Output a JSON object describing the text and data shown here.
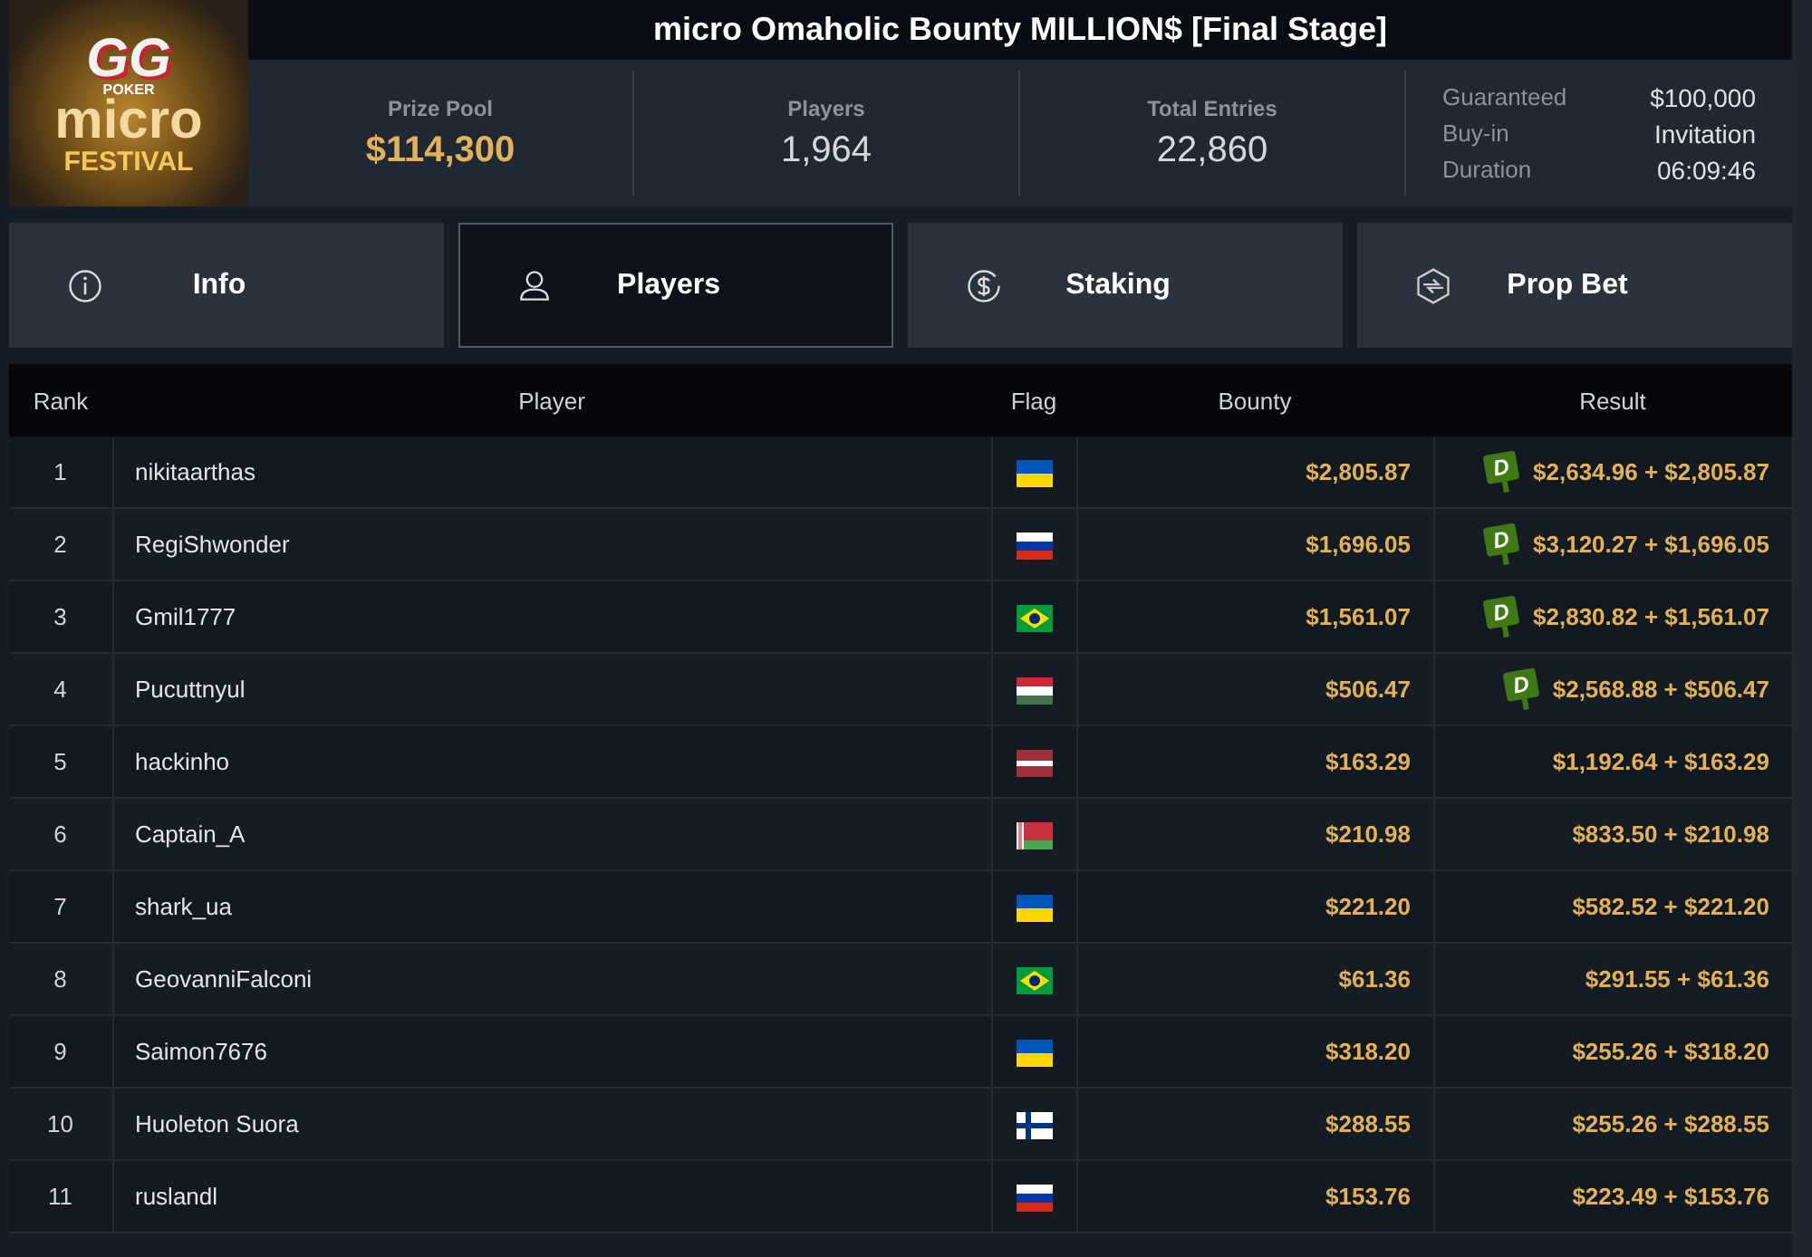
{
  "logo": {
    "brand": "GG",
    "sub": "POKER",
    "line1": "micro",
    "line2": "FESTIVAL"
  },
  "title": "micro Omaholic Bounty MILLION$ [Final Stage]",
  "stats": [
    {
      "label": "Prize Pool",
      "value": "$114,300",
      "kind": "money"
    },
    {
      "label": "Players",
      "value": "1,964",
      "kind": "plain"
    },
    {
      "label": "Total Entries",
      "value": "22,860",
      "kind": "plain"
    }
  ],
  "details": [
    {
      "label": "Guaranteed",
      "value": "$100,000"
    },
    {
      "label": "Buy-in",
      "value": "Invitation"
    },
    {
      "label": "Duration",
      "value": "06:09:46"
    }
  ],
  "tabs": [
    {
      "label": "Info",
      "selected": false
    },
    {
      "label": "Players",
      "selected": true
    },
    {
      "label": "Staking",
      "selected": false
    },
    {
      "label": "Prop Bet",
      "selected": false
    }
  ],
  "table": {
    "columns": [
      "Rank",
      "Player",
      "Flag",
      "Bounty",
      "Result"
    ],
    "rows": [
      {
        "rank": "1",
        "player": "nikitaarthas",
        "kind": "ua",
        "bounty": "$2,805.87",
        "deal": "D",
        "result": "$2,634.96 + $2,805.87"
      },
      {
        "rank": "2",
        "player": "RegiShwonder",
        "kind": "ru",
        "bounty": "$1,696.05",
        "deal": "D",
        "result": "$3,120.27 + $1,696.05"
      },
      {
        "rank": "3",
        "player": "Gmil1777",
        "kind": "br",
        "bounty": "$1,561.07",
        "deal": "D",
        "result": "$2,830.82 + $1,561.07"
      },
      {
        "rank": "4",
        "player": "Pucuttnyul",
        "kind": "hu",
        "bounty": "$506.47",
        "deal": "D",
        "result": "$2,568.88 + $506.47"
      },
      {
        "rank": "5",
        "player": "hackinho",
        "kind": "lv",
        "bounty": "$163.29",
        "result": "$1,192.64 + $163.29"
      },
      {
        "rank": "6",
        "player": "Captain_A",
        "kind": "by",
        "bounty": "$210.98",
        "result": "$833.50 + $210.98"
      },
      {
        "rank": "7",
        "player": "shark_ua",
        "kind": "ua",
        "bounty": "$221.20",
        "result": "$582.52 + $221.20"
      },
      {
        "rank": "8",
        "player": "GeovanniFalconi",
        "kind": "br",
        "bounty": "$61.36",
        "result": "$291.55 + $61.36"
      },
      {
        "rank": "9",
        "player": "Saimon7676",
        "kind": "ua",
        "bounty": "$318.20",
        "result": "$255.26 + $318.20"
      },
      {
        "rank": "10",
        "player": "Huoleton Suora",
        "kind": "fi",
        "bounty": "$288.55",
        "result": "$255.26 + $288.55"
      },
      {
        "rank": "11",
        "player": "ruslandl",
        "kind": "ru",
        "bounty": "$153.76",
        "result": "$223.49 + $153.76"
      }
    ]
  }
}
